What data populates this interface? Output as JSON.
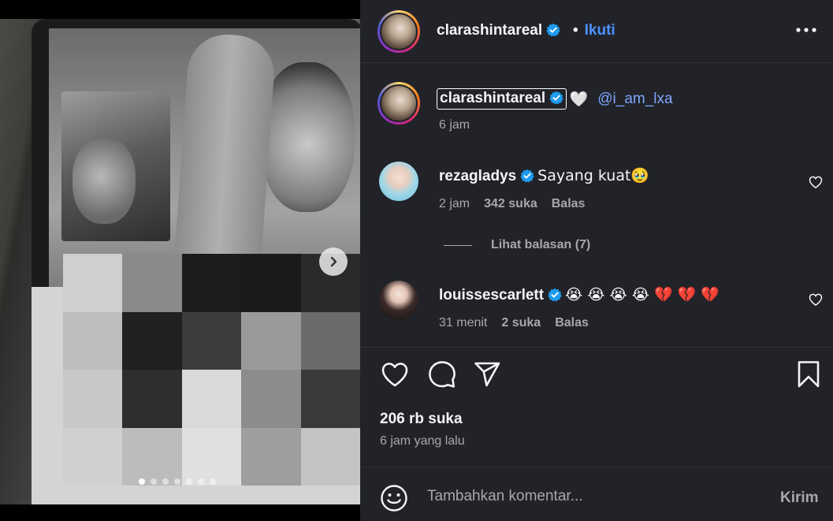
{
  "post": {
    "author": "clarashintareal",
    "follow_label": "Ikuti",
    "dot": "•"
  },
  "caption": {
    "author": "clarashintareal",
    "heart": "🤍",
    "mention": "@i_am_lxa",
    "time": "6 jam"
  },
  "comments": [
    {
      "user": "rezagladys",
      "text": "Sayang kuat🥹",
      "time": "2 jam",
      "likes": "342 suka",
      "reply_label": "Balas"
    },
    {
      "user": "louissescarlett",
      "text": "😭 😭 😭 😭 💔 💔 💔",
      "time": "31 menit",
      "likes": "2 suka",
      "reply_label": "Balas"
    }
  ],
  "view_replies": "Lihat balasan (7)",
  "stats": {
    "likes": "206 rb suka",
    "time_ago": "6 jam yang lalu"
  },
  "composer": {
    "placeholder": "Tambahkan komentar...",
    "send_label": "Kirim"
  },
  "carousel": {
    "total_slides": 7,
    "current_slide": 1
  },
  "colors": {
    "panel_bg": "#212328",
    "link_blue": "#4c90ff",
    "mention_blue": "#7fa6ff",
    "verified": "#1d9bf0",
    "muted_text": "#a8a8a8"
  },
  "icons": [
    "verified-badge-icon",
    "more-options-icon",
    "heart-icon",
    "comment-icon",
    "share-icon",
    "bookmark-icon",
    "emoji-icon",
    "chevron-right-icon"
  ]
}
